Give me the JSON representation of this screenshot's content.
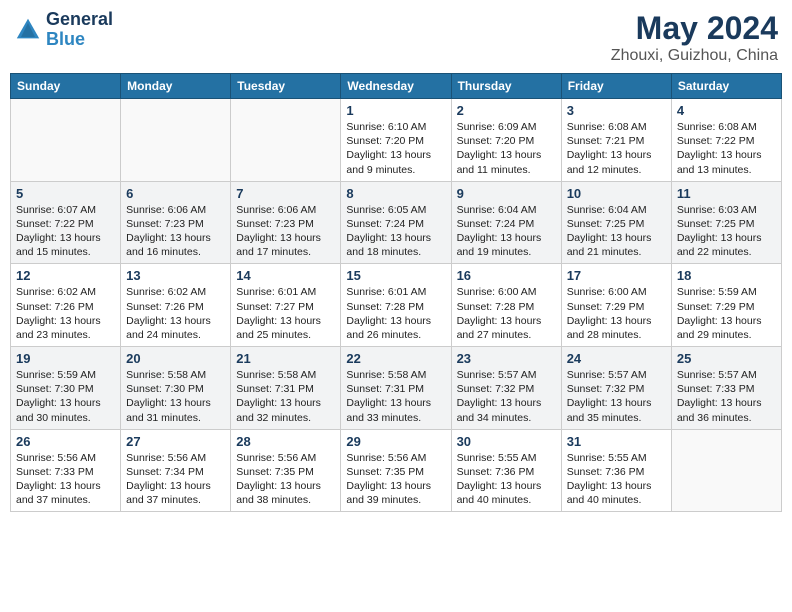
{
  "header": {
    "logo_line1": "General",
    "logo_line2": "Blue",
    "title": "May 2024",
    "subtitle": "Zhouxi, Guizhou, China"
  },
  "weekdays": [
    "Sunday",
    "Monday",
    "Tuesday",
    "Wednesday",
    "Thursday",
    "Friday",
    "Saturday"
  ],
  "weeks": [
    [
      {
        "day": "",
        "sunrise": "",
        "sunset": "",
        "daylight": ""
      },
      {
        "day": "",
        "sunrise": "",
        "sunset": "",
        "daylight": ""
      },
      {
        "day": "",
        "sunrise": "",
        "sunset": "",
        "daylight": ""
      },
      {
        "day": "1",
        "sunrise": "Sunrise: 6:10 AM",
        "sunset": "Sunset: 7:20 PM",
        "daylight": "Daylight: 13 hours and 9 minutes."
      },
      {
        "day": "2",
        "sunrise": "Sunrise: 6:09 AM",
        "sunset": "Sunset: 7:20 PM",
        "daylight": "Daylight: 13 hours and 11 minutes."
      },
      {
        "day": "3",
        "sunrise": "Sunrise: 6:08 AM",
        "sunset": "Sunset: 7:21 PM",
        "daylight": "Daylight: 13 hours and 12 minutes."
      },
      {
        "day": "4",
        "sunrise": "Sunrise: 6:08 AM",
        "sunset": "Sunset: 7:22 PM",
        "daylight": "Daylight: 13 hours and 13 minutes."
      }
    ],
    [
      {
        "day": "5",
        "sunrise": "Sunrise: 6:07 AM",
        "sunset": "Sunset: 7:22 PM",
        "daylight": "Daylight: 13 hours and 15 minutes."
      },
      {
        "day": "6",
        "sunrise": "Sunrise: 6:06 AM",
        "sunset": "Sunset: 7:23 PM",
        "daylight": "Daylight: 13 hours and 16 minutes."
      },
      {
        "day": "7",
        "sunrise": "Sunrise: 6:06 AM",
        "sunset": "Sunset: 7:23 PM",
        "daylight": "Daylight: 13 hours and 17 minutes."
      },
      {
        "day": "8",
        "sunrise": "Sunrise: 6:05 AM",
        "sunset": "Sunset: 7:24 PM",
        "daylight": "Daylight: 13 hours and 18 minutes."
      },
      {
        "day": "9",
        "sunrise": "Sunrise: 6:04 AM",
        "sunset": "Sunset: 7:24 PM",
        "daylight": "Daylight: 13 hours and 19 minutes."
      },
      {
        "day": "10",
        "sunrise": "Sunrise: 6:04 AM",
        "sunset": "Sunset: 7:25 PM",
        "daylight": "Daylight: 13 hours and 21 minutes."
      },
      {
        "day": "11",
        "sunrise": "Sunrise: 6:03 AM",
        "sunset": "Sunset: 7:25 PM",
        "daylight": "Daylight: 13 hours and 22 minutes."
      }
    ],
    [
      {
        "day": "12",
        "sunrise": "Sunrise: 6:02 AM",
        "sunset": "Sunset: 7:26 PM",
        "daylight": "Daylight: 13 hours and 23 minutes."
      },
      {
        "day": "13",
        "sunrise": "Sunrise: 6:02 AM",
        "sunset": "Sunset: 7:26 PM",
        "daylight": "Daylight: 13 hours and 24 minutes."
      },
      {
        "day": "14",
        "sunrise": "Sunrise: 6:01 AM",
        "sunset": "Sunset: 7:27 PM",
        "daylight": "Daylight: 13 hours and 25 minutes."
      },
      {
        "day": "15",
        "sunrise": "Sunrise: 6:01 AM",
        "sunset": "Sunset: 7:28 PM",
        "daylight": "Daylight: 13 hours and 26 minutes."
      },
      {
        "day": "16",
        "sunrise": "Sunrise: 6:00 AM",
        "sunset": "Sunset: 7:28 PM",
        "daylight": "Daylight: 13 hours and 27 minutes."
      },
      {
        "day": "17",
        "sunrise": "Sunrise: 6:00 AM",
        "sunset": "Sunset: 7:29 PM",
        "daylight": "Daylight: 13 hours and 28 minutes."
      },
      {
        "day": "18",
        "sunrise": "Sunrise: 5:59 AM",
        "sunset": "Sunset: 7:29 PM",
        "daylight": "Daylight: 13 hours and 29 minutes."
      }
    ],
    [
      {
        "day": "19",
        "sunrise": "Sunrise: 5:59 AM",
        "sunset": "Sunset: 7:30 PM",
        "daylight": "Daylight: 13 hours and 30 minutes."
      },
      {
        "day": "20",
        "sunrise": "Sunrise: 5:58 AM",
        "sunset": "Sunset: 7:30 PM",
        "daylight": "Daylight: 13 hours and 31 minutes."
      },
      {
        "day": "21",
        "sunrise": "Sunrise: 5:58 AM",
        "sunset": "Sunset: 7:31 PM",
        "daylight": "Daylight: 13 hours and 32 minutes."
      },
      {
        "day": "22",
        "sunrise": "Sunrise: 5:58 AM",
        "sunset": "Sunset: 7:31 PM",
        "daylight": "Daylight: 13 hours and 33 minutes."
      },
      {
        "day": "23",
        "sunrise": "Sunrise: 5:57 AM",
        "sunset": "Sunset: 7:32 PM",
        "daylight": "Daylight: 13 hours and 34 minutes."
      },
      {
        "day": "24",
        "sunrise": "Sunrise: 5:57 AM",
        "sunset": "Sunset: 7:32 PM",
        "daylight": "Daylight: 13 hours and 35 minutes."
      },
      {
        "day": "25",
        "sunrise": "Sunrise: 5:57 AM",
        "sunset": "Sunset: 7:33 PM",
        "daylight": "Daylight: 13 hours and 36 minutes."
      }
    ],
    [
      {
        "day": "26",
        "sunrise": "Sunrise: 5:56 AM",
        "sunset": "Sunset: 7:33 PM",
        "daylight": "Daylight: 13 hours and 37 minutes."
      },
      {
        "day": "27",
        "sunrise": "Sunrise: 5:56 AM",
        "sunset": "Sunset: 7:34 PM",
        "daylight": "Daylight: 13 hours and 37 minutes."
      },
      {
        "day": "28",
        "sunrise": "Sunrise: 5:56 AM",
        "sunset": "Sunset: 7:35 PM",
        "daylight": "Daylight: 13 hours and 38 minutes."
      },
      {
        "day": "29",
        "sunrise": "Sunrise: 5:56 AM",
        "sunset": "Sunset: 7:35 PM",
        "daylight": "Daylight: 13 hours and 39 minutes."
      },
      {
        "day": "30",
        "sunrise": "Sunrise: 5:55 AM",
        "sunset": "Sunset: 7:36 PM",
        "daylight": "Daylight: 13 hours and 40 minutes."
      },
      {
        "day": "31",
        "sunrise": "Sunrise: 5:55 AM",
        "sunset": "Sunset: 7:36 PM",
        "daylight": "Daylight: 13 hours and 40 minutes."
      },
      {
        "day": "",
        "sunrise": "",
        "sunset": "",
        "daylight": ""
      }
    ]
  ]
}
